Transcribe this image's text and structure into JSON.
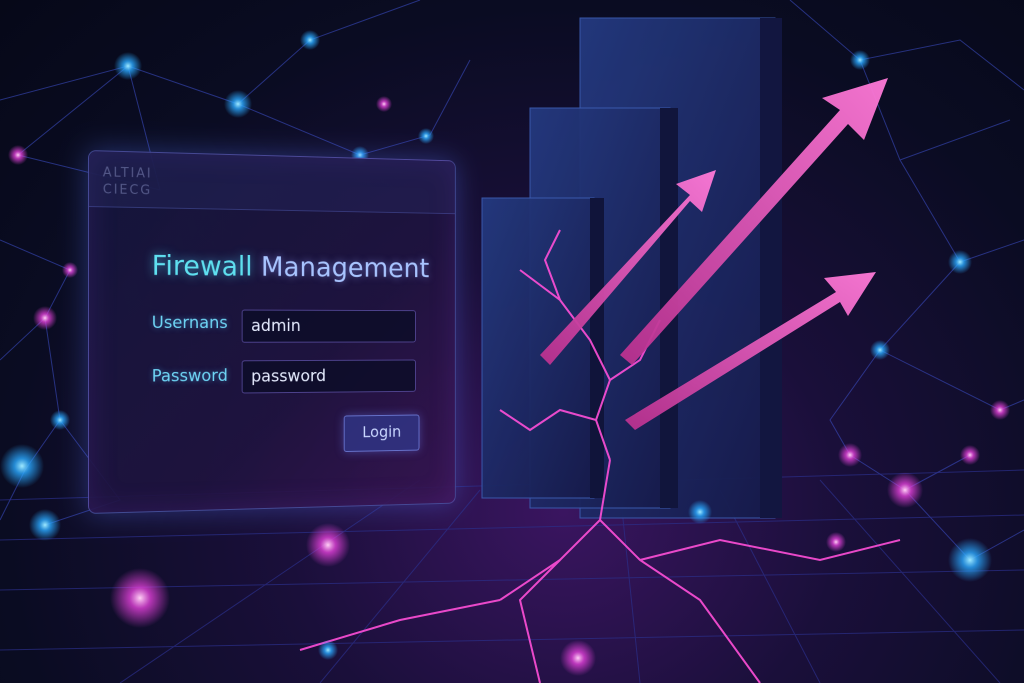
{
  "brand": {
    "line1": "ALTIAI",
    "line2": "CIECG"
  },
  "login": {
    "title_part1": "Firewall",
    "title_part2": "Management",
    "username_label": "Usernans",
    "username_value": "admin",
    "password_label": "Password",
    "password_value": "password",
    "login_button": "Login"
  },
  "colors": {
    "title_accent": "#5fe0f0",
    "label": "#6fd6f6",
    "arrow": "#ff5cc8",
    "crack": "#ff4fd8"
  }
}
